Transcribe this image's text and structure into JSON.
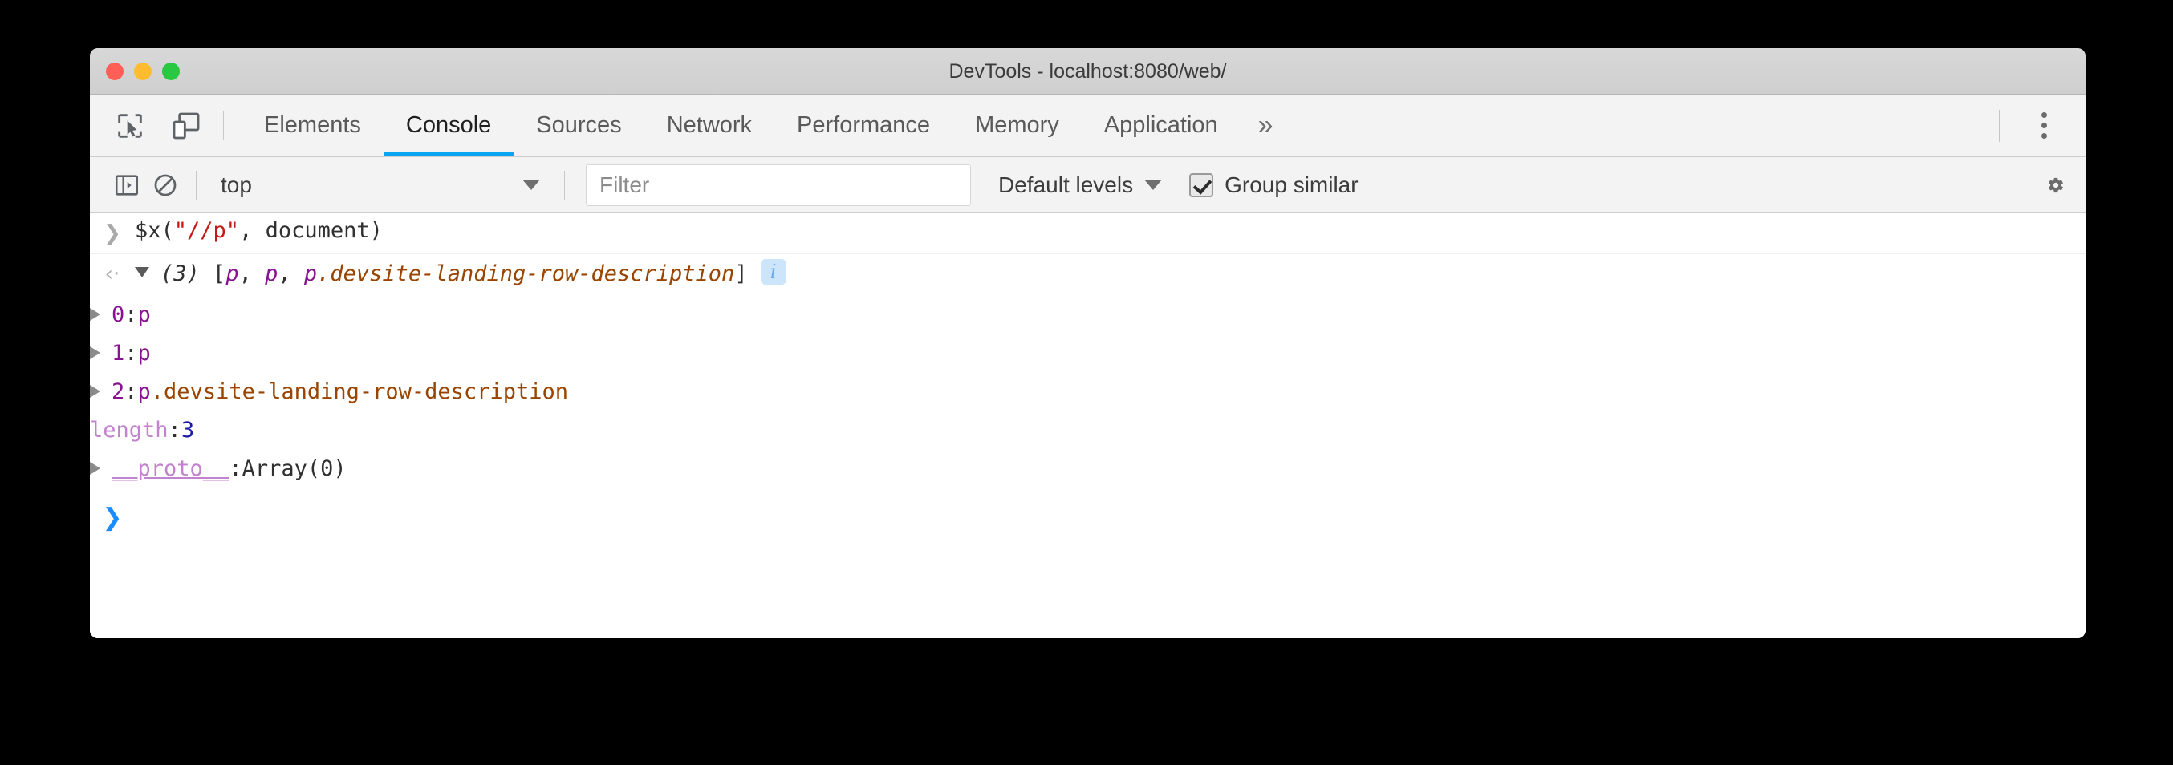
{
  "window": {
    "title": "DevTools - localhost:8080/web/",
    "traffic_lights": [
      "close",
      "minimize",
      "maximize"
    ]
  },
  "theme": {
    "accent": "#0aa5f0",
    "titlebar_bg": "#d4d4d4",
    "toolbar_bg": "#f3f3f3",
    "console_bg": "#ffffff",
    "string_color": "#c41a16",
    "tag_color": "#881391",
    "class_color": "#994500",
    "number_color": "#1a1aa6",
    "proto_color": "#c183cd",
    "prompt_color": "#1a8cff"
  },
  "tabbar": {
    "left_icons": [
      {
        "name": "inspect-element-icon",
        "title": "Inspect"
      },
      {
        "name": "device-toolbar-icon",
        "title": "Toggle device toolbar"
      }
    ],
    "tabs": [
      {
        "label": "Elements",
        "active": false
      },
      {
        "label": "Console",
        "active": true
      },
      {
        "label": "Sources",
        "active": false
      },
      {
        "label": "Network",
        "active": false
      },
      {
        "label": "Performance",
        "active": false
      },
      {
        "label": "Memory",
        "active": false
      },
      {
        "label": "Application",
        "active": false
      }
    ],
    "more_label": "»",
    "kebab": "more-options"
  },
  "console_toolbar": {
    "sidebar_toggle": "console-sidebar-icon",
    "clear_console": "clear-console-icon",
    "context": {
      "value": "top",
      "caret": "▼"
    },
    "filter": {
      "value": "",
      "placeholder": "Filter"
    },
    "levels": {
      "label": "Default levels",
      "caret": "▼"
    },
    "group_similar": {
      "label": "Group similar",
      "checked": true
    },
    "settings": "settings-gear-icon"
  },
  "console": {
    "command": {
      "prompt": "❯",
      "parts": [
        {
          "text": "$x(",
          "type": "plain"
        },
        {
          "text": "\"//p\"",
          "type": "string"
        },
        {
          "text": ", document)",
          "type": "plain"
        }
      ],
      "full_text": "$x(\"//p\", document)"
    },
    "result": {
      "return_arrow": "‹·",
      "expanded": true,
      "count_label": "(3)",
      "preview_parts": [
        {
          "text": "[",
          "type": "plain"
        },
        {
          "text": "p",
          "type": "tag"
        },
        {
          "text": ", ",
          "type": "plain"
        },
        {
          "text": "p",
          "type": "tag"
        },
        {
          "text": ", ",
          "type": "plain"
        },
        {
          "text": "p",
          "type": "tag"
        },
        {
          "text": ".devsite-landing-row-description",
          "type": "class"
        },
        {
          "text": "]",
          "type": "plain"
        }
      ],
      "preview_text": "(3) [p, p, p.devsite-landing-row-description]",
      "info_badge": "i",
      "children": [
        {
          "expandable": true,
          "key": "0",
          "key_type": "index",
          "value_parts": [
            {
              "text": "p",
              "type": "tag"
            }
          ],
          "value_text": "p"
        },
        {
          "expandable": true,
          "key": "1",
          "key_type": "index",
          "value_parts": [
            {
              "text": "p",
              "type": "tag"
            }
          ],
          "value_text": "p"
        },
        {
          "expandable": true,
          "key": "2",
          "key_type": "index",
          "value_parts": [
            {
              "text": "p",
              "type": "tag"
            },
            {
              "text": ".devsite-landing-row-description",
              "type": "class"
            }
          ],
          "value_text": "p.devsite-landing-row-description"
        },
        {
          "expandable": false,
          "key": "length",
          "key_type": "length",
          "value_parts": [
            {
              "text": "3",
              "type": "number"
            }
          ],
          "value_text": "3"
        },
        {
          "expandable": true,
          "key": "__proto__",
          "key_type": "proto",
          "value_parts": [
            {
              "text": "Array(0)",
              "type": "object"
            }
          ],
          "value_text": "Array(0)"
        }
      ]
    },
    "input_prompt": {
      "chevron": "❯",
      "value": ""
    }
  }
}
